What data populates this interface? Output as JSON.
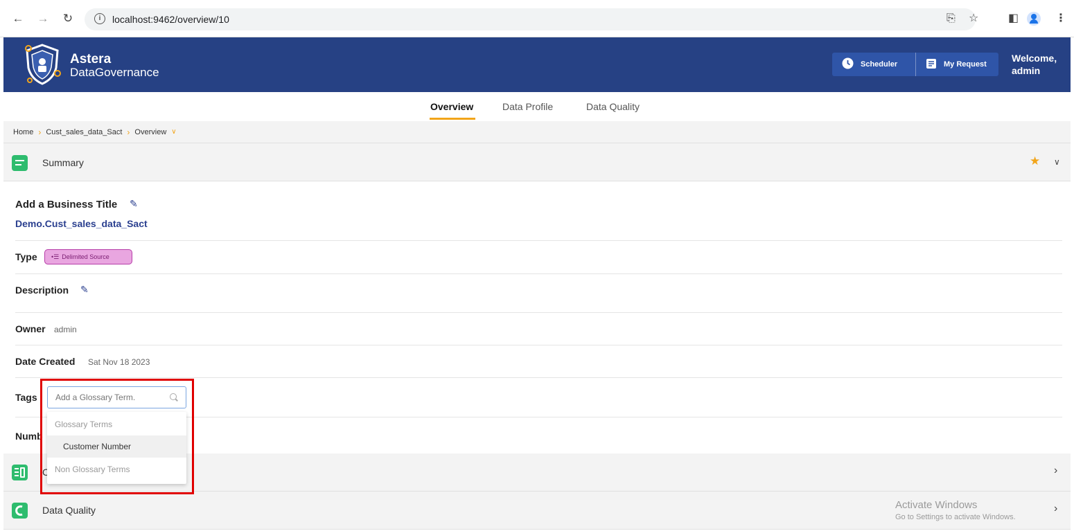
{
  "browser": {
    "url": "localhost:9462/overview/10",
    "back_icon": "arrow-left-icon",
    "forward_icon": "arrow-right-icon",
    "reload_icon": "reload-icon"
  },
  "header": {
    "brand_line1": "Astera",
    "brand_line2": "DataGovernance",
    "scheduler_label": "Scheduler",
    "my_request_label": "My Request",
    "welcome_line1": "Welcome,",
    "welcome_line2": "admin",
    "bg_color": "#264184"
  },
  "tabs": [
    {
      "label": "Overview",
      "active": true
    },
    {
      "label": "Data Profile",
      "active": false
    },
    {
      "label": "Data Quality",
      "active": false
    }
  ],
  "breadcrumb": [
    "Home",
    "Cust_sales_data_Sact",
    "Overview"
  ],
  "summary": {
    "title": "Summary",
    "business_title": "Add a Business Title",
    "asset_name": "Demo.Cust_sales_data_Sact",
    "type_label": "Type",
    "type_value": "Delimited Source",
    "description_label": "Description",
    "owner_label": "Owner",
    "owner_value": "admin",
    "date_label": "Date Created",
    "date_value": "Sat Nov 18 2023",
    "tags_label": "Tags",
    "number_label": "Numb"
  },
  "tag_search": {
    "placeholder": "Add a Glossary Term.",
    "group_glossary": "Glossary Terms",
    "item": "Customer Number",
    "group_non_glossary": "Non Glossary Terms"
  },
  "sections": {
    "collapsed_label": "C",
    "data_quality": "Data Quality"
  },
  "watermark": {
    "line1": "Activate Windows",
    "line2": "Go to Settings to activate Windows."
  }
}
